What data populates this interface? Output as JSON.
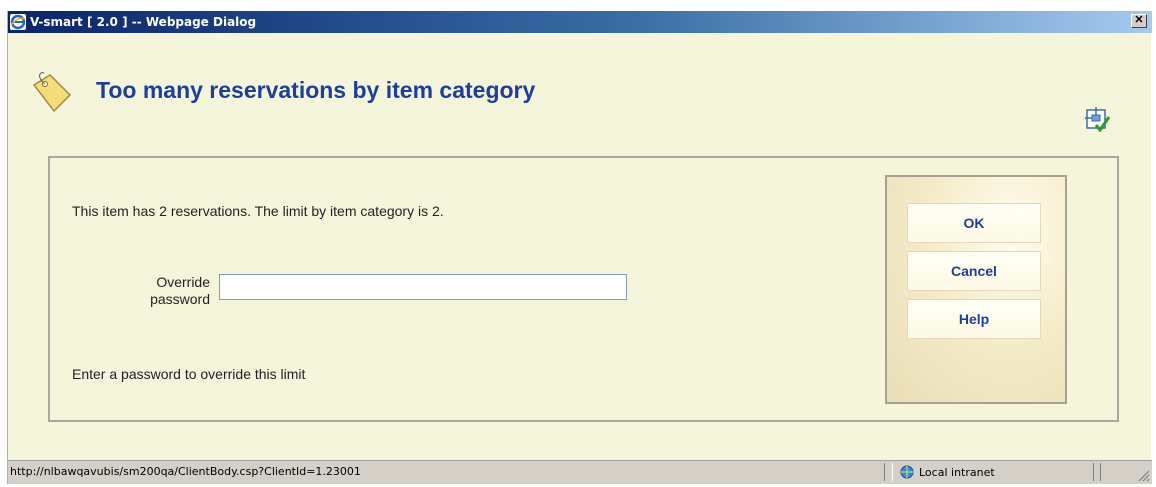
{
  "window": {
    "title": "V-smart [ 2.0 ] -- Webpage Dialog",
    "close_glyph": "✕"
  },
  "header": {
    "title": "Too many reservations by item category"
  },
  "form": {
    "message": "This item has 2 reservations. The limit by item category is 2.",
    "password_label_line1": "Override",
    "password_label_line2": "password",
    "password_value": "",
    "hint": "Enter a password to override this limit"
  },
  "buttons": {
    "ok": "OK",
    "cancel": "Cancel",
    "help": "Help"
  },
  "status": {
    "url": "http://nlbawqavubis/sm200qa/ClientBody.csp?ClientId=1.23001",
    "zone": "Local intranet"
  },
  "colors": {
    "title_blue": "#1c3f9c",
    "background": "#f5f5dc",
    "titlebar": "#0a246a"
  },
  "icons": [
    "ie-icon",
    "close-icon",
    "tag-icon",
    "layout-toggle-icon",
    "intranet-icon",
    "resize-grip-icon"
  ]
}
